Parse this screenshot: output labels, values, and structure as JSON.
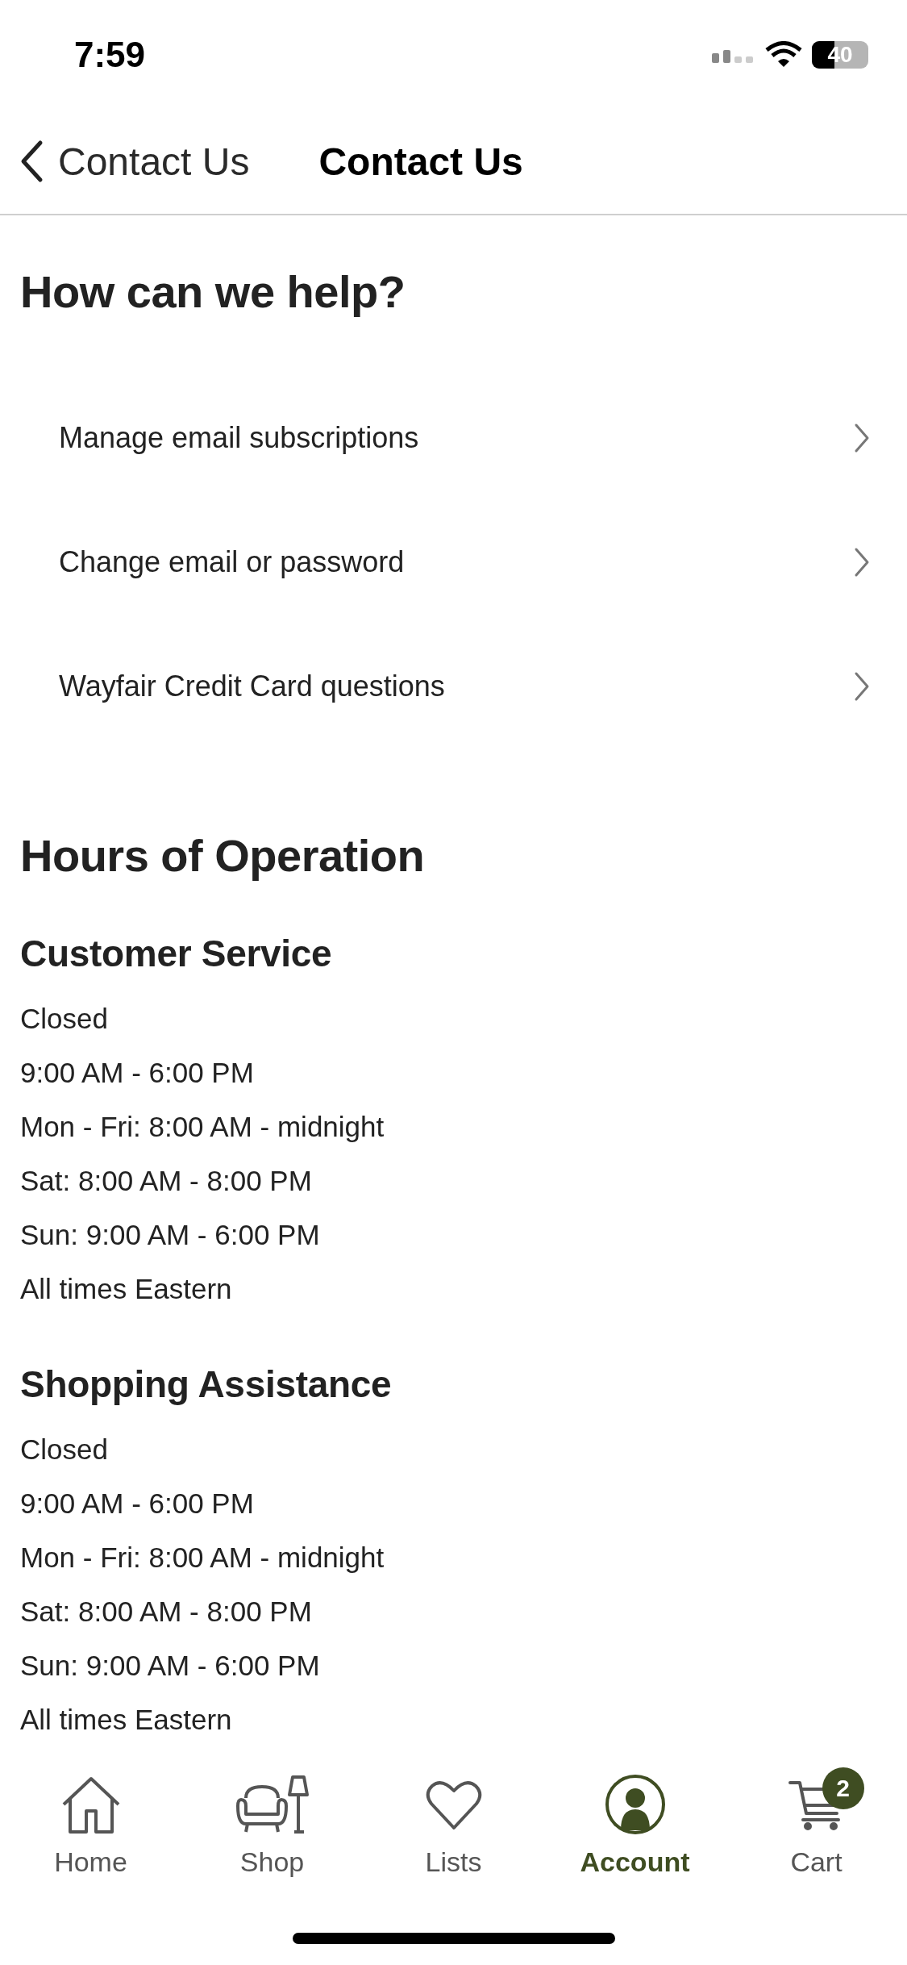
{
  "status_bar": {
    "time": "7:59",
    "battery": "40"
  },
  "nav": {
    "back_label": "Contact Us",
    "title": "Contact Us"
  },
  "help": {
    "heading": "How can we help?",
    "items": [
      {
        "label": "Manage email subscriptions"
      },
      {
        "label": "Change email or password"
      },
      {
        "label": "Wayfair Credit Card questions"
      }
    ]
  },
  "hours": {
    "heading": "Hours of Operation",
    "sections": [
      {
        "title": "Customer Service",
        "lines": [
          "Closed",
          "9:00 AM - 6:00 PM",
          "Mon - Fri: 8:00 AM - midnight",
          "Sat: 8:00 AM - 8:00 PM",
          "Sun: 9:00 AM - 6:00 PM",
          "All times Eastern"
        ]
      },
      {
        "title": "Shopping Assistance",
        "lines": [
          "Closed",
          "9:00 AM - 6:00 PM",
          "Mon - Fri: 8:00 AM - midnight",
          "Sat: 8:00 AM - 8:00 PM",
          "Sun: 9:00 AM - 6:00 PM",
          "All times Eastern"
        ]
      }
    ]
  },
  "tab_bar": [
    {
      "kind": "home",
      "label": "Home",
      "selected": false
    },
    {
      "kind": "shop",
      "label": "Shop",
      "selected": false
    },
    {
      "kind": "lists",
      "label": "Lists",
      "selected": false
    },
    {
      "kind": "account",
      "label": "Account",
      "selected": true
    },
    {
      "kind": "cart",
      "label": "Cart",
      "selected": false,
      "badge": "2"
    }
  ]
}
